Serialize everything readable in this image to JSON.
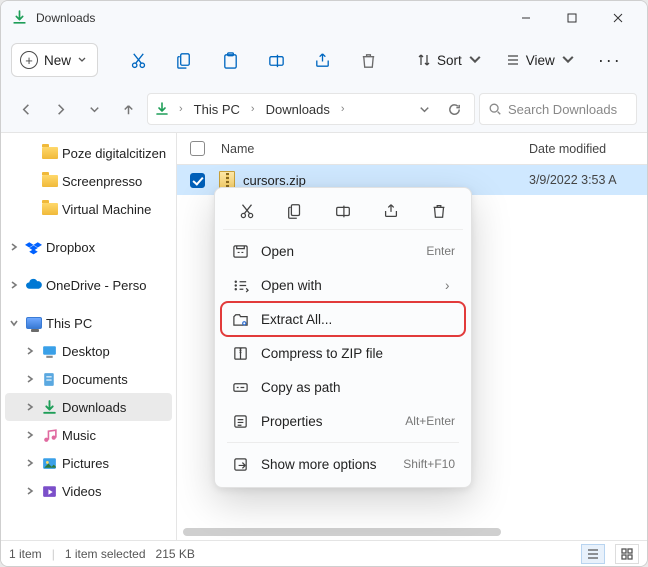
{
  "window": {
    "title": "Downloads"
  },
  "toolbar": {
    "new_label": "New",
    "sort_label": "Sort",
    "view_label": "View"
  },
  "address": {
    "segments": [
      "This PC",
      "Downloads"
    ]
  },
  "search": {
    "placeholder": "Search Downloads"
  },
  "sidebar": {
    "quick": [
      {
        "label": "Poze digitalcitizen",
        "icon": "folder"
      },
      {
        "label": "Screenpresso",
        "icon": "folder"
      },
      {
        "label": "Virtual Machine",
        "icon": "folder"
      }
    ],
    "cloud": [
      {
        "label": "Dropbox",
        "icon": "dropbox",
        "expandable": true
      },
      {
        "label": "OneDrive - Perso",
        "icon": "onedrive",
        "expandable": true
      }
    ],
    "thispc": {
      "label": "This PC",
      "children": [
        {
          "label": "Desktop",
          "icon": "desktop",
          "expandable": true
        },
        {
          "label": "Documents",
          "icon": "documents",
          "expandable": true
        },
        {
          "label": "Downloads",
          "icon": "downloads",
          "expandable": true,
          "selected": true
        },
        {
          "label": "Music",
          "icon": "music",
          "expandable": true
        },
        {
          "label": "Pictures",
          "icon": "pictures",
          "expandable": true
        },
        {
          "label": "Videos",
          "icon": "videos",
          "expandable": true
        }
      ]
    }
  },
  "columns": {
    "name": "Name",
    "date": "Date modified"
  },
  "files": [
    {
      "name": "cursors.zip",
      "date": "3/9/2022 3:53 A",
      "selected": true,
      "icon": "zip"
    }
  ],
  "context_menu": {
    "items": [
      {
        "label": "Open",
        "accel": "Enter",
        "icon": "open"
      },
      {
        "label": "Open with",
        "chevron": true,
        "icon": "openwith"
      },
      {
        "label": "Extract All...",
        "icon": "extract",
        "highlight": true
      },
      {
        "label": "Compress to ZIP file",
        "icon": "compress"
      },
      {
        "label": "Copy as path",
        "icon": "copypath"
      },
      {
        "label": "Properties",
        "accel": "Alt+Enter",
        "icon": "properties"
      }
    ],
    "more": {
      "label": "Show more options",
      "accel": "Shift+F10"
    }
  },
  "status": {
    "count": "1 item",
    "selection": "1 item selected",
    "size": "215 KB"
  }
}
